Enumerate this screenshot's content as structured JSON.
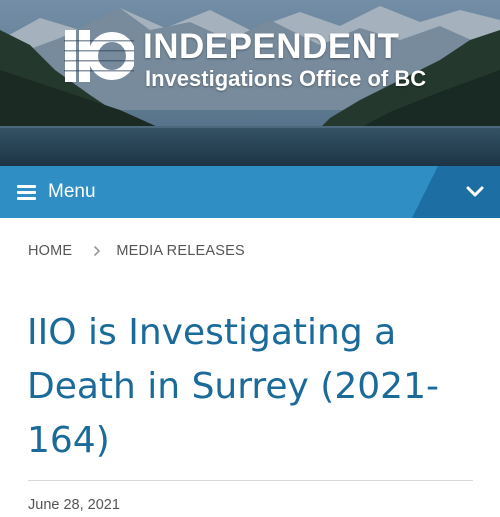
{
  "header": {
    "logo_text": "IIO",
    "brand_title": "INDEPENDENT",
    "brand_subtitle": "Investigations Office of BC"
  },
  "nav": {
    "menu_label": "Menu",
    "toggle_icon": "chevron-down-icon"
  },
  "breadcrumb": {
    "items": [
      {
        "label": "HOME"
      },
      {
        "label": "MEDIA RELEASES"
      }
    ],
    "separator_icon": "chevron-right-icon"
  },
  "article": {
    "title": "IIO is Investigating a Death in Surrey (2021-164)",
    "date": "June 28, 2021"
  },
  "colors": {
    "menu_bar": "#2f8ec4",
    "menu_toggle_panel": "#1d6fa3",
    "title_text": "#1a6a9a",
    "body_text": "#555555"
  }
}
